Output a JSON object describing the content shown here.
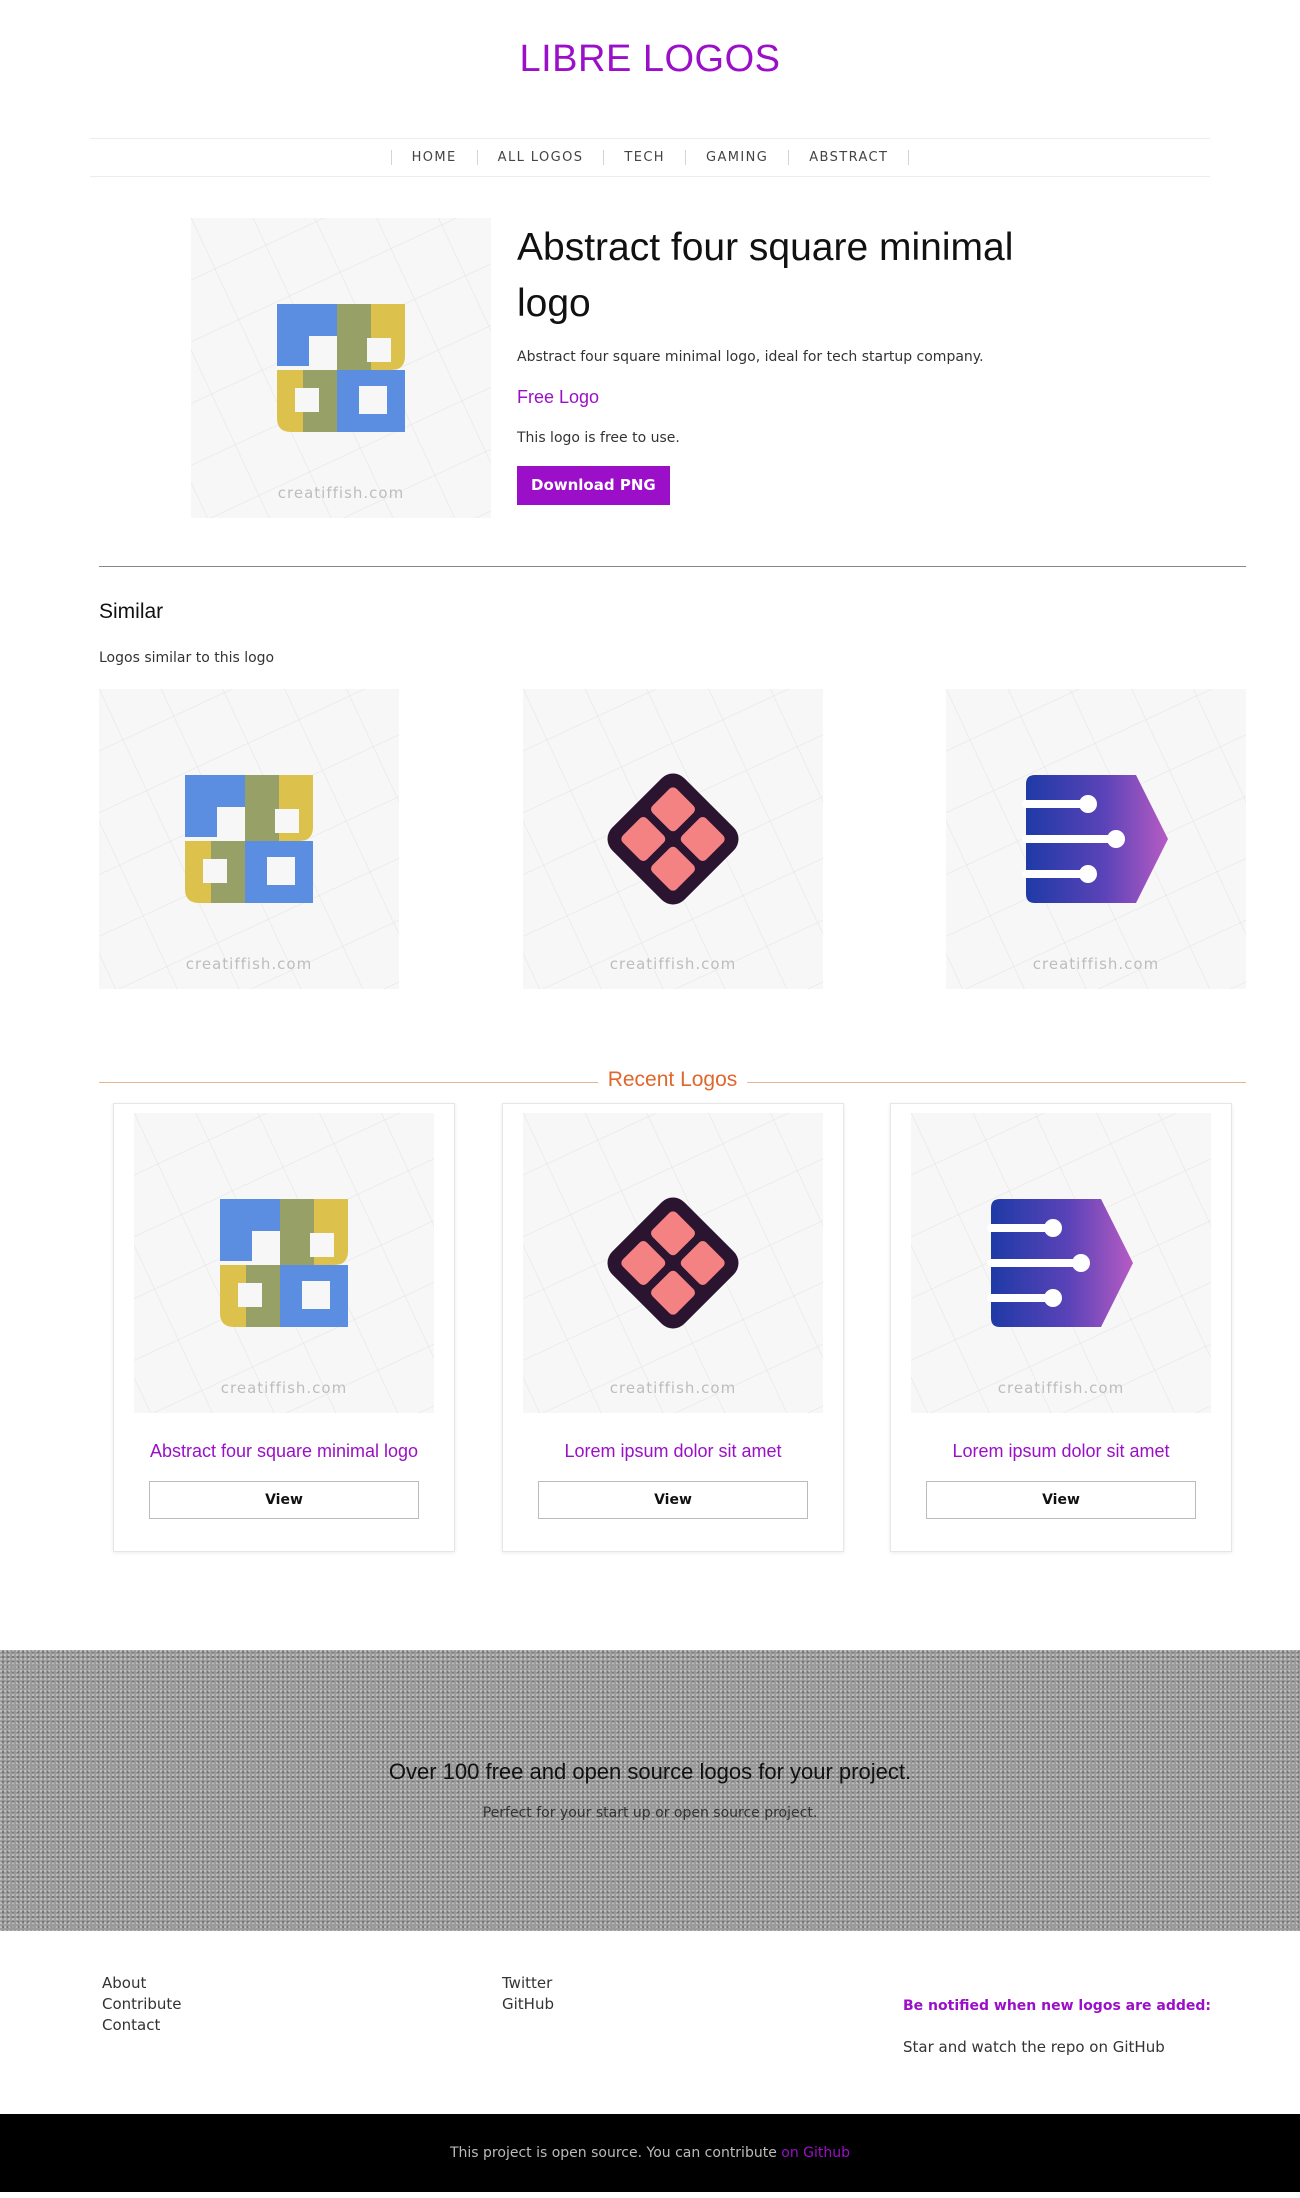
{
  "site": {
    "title": "LIBRE LOGOS"
  },
  "nav": {
    "items": [
      "HOME",
      "ALL LOGOS",
      "TECH",
      "GAMING",
      "ABSTRACT"
    ]
  },
  "hero": {
    "title": "Abstract four square minimal logo",
    "description": "Abstract four square minimal logo, ideal for tech startup company.",
    "license_title": "Free Logo",
    "license_text": "This logo is free to use.",
    "download_label": "Download PNG",
    "watermark": "creatiffish.com"
  },
  "similar": {
    "heading": "Similar",
    "subheading": "Logos similar to this logo",
    "items": [
      {
        "icon": "four-square-logo-icon",
        "watermark": "creatiffish.com"
      },
      {
        "icon": "pink-diamond-logo-icon",
        "watermark": "creatiffish.com"
      },
      {
        "icon": "circuit-tag-logo-icon",
        "watermark": "creatiffish.com"
      }
    ]
  },
  "recent": {
    "heading": "Recent Logos",
    "cards": [
      {
        "title": "Abstract four square minimal logo",
        "button": "View",
        "icon": "four-square-logo-icon",
        "watermark": "creatiffish.com"
      },
      {
        "title": "Lorem ipsum dolor sit amet",
        "button": "View",
        "icon": "pink-diamond-logo-icon",
        "watermark": "creatiffish.com"
      },
      {
        "title": "Lorem ipsum dolor sit amet",
        "button": "View",
        "icon": "circuit-tag-logo-icon",
        "watermark": "creatiffish.com"
      }
    ]
  },
  "promo": {
    "headline": "Over 100 free and open source logos for your project.",
    "subline": "Perfect for your start up or open source project."
  },
  "footer": {
    "col1": [
      "About",
      "Contribute",
      "Contact"
    ],
    "col2": [
      "Twitter",
      "GitHub"
    ],
    "notify": "Be notified when new logos are added:",
    "star": "Star and watch the repo on GitHub"
  },
  "bottom_bar": {
    "text": "This project is open source. You can contribute ",
    "link": "on Github"
  },
  "colors": {
    "brand": "#9b0fc9",
    "accent_orange": "#e0672c",
    "footer_bg": "#000000"
  }
}
